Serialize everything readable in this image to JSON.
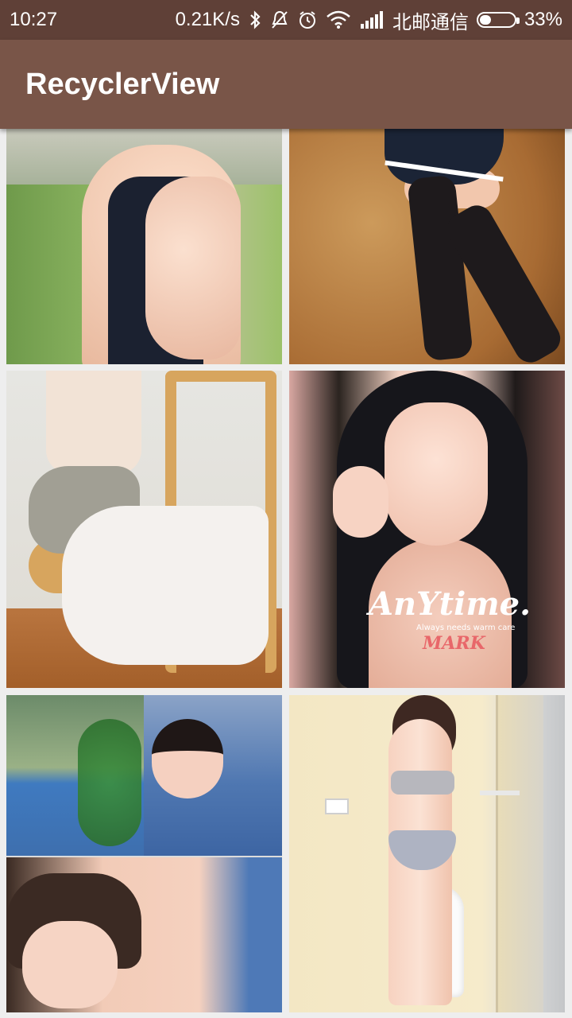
{
  "status_bar": {
    "time": "10:27",
    "network_speed": "0.21K/s",
    "carrier": "北邮通信",
    "battery_percent": "33%",
    "battery_level": 0.33,
    "icons": [
      "bluetooth-icon",
      "mute-icon",
      "alarm-icon",
      "wifi-icon",
      "signal-icon",
      "battery-icon"
    ]
  },
  "app_bar": {
    "title": "RecyclerView",
    "color": "#795548"
  },
  "grid": {
    "items": [
      {
        "name": "image-1",
        "watermark": null
      },
      {
        "name": "image-2",
        "watermark": null
      },
      {
        "name": "image-3",
        "watermark": null
      },
      {
        "name": "image-4",
        "watermark_title": "AnYtime.",
        "watermark_sub": "Always needs warm care",
        "watermark_mark": "MARK"
      },
      {
        "name": "image-5",
        "watermark": null
      },
      {
        "name": "image-6",
        "watermark": null
      }
    ]
  },
  "colors": {
    "status_bar": "#5f4037",
    "app_bar": "#795548",
    "background": "#eeeeee"
  }
}
